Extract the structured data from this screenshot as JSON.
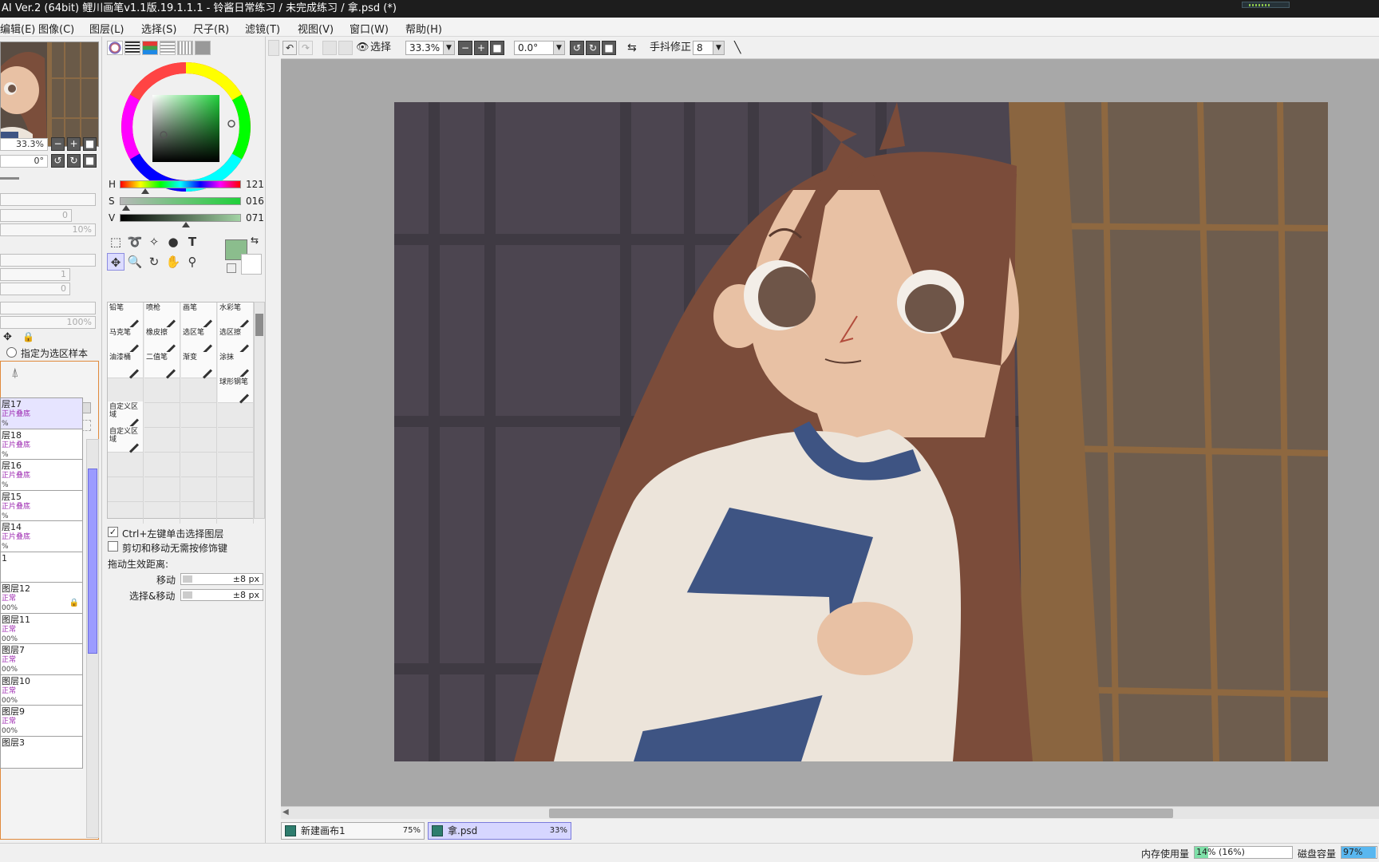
{
  "title": "AI Ver.2 (64bit) 鲤川画笔v1.1版.19.1.1.1 - 铃酱日常练习 / 未完成练习 / 拿.psd (*)",
  "menu": [
    "编辑(E)",
    "图像(C)",
    "图层(L)",
    "选择(S)",
    "尺子(R)",
    "滤镜(T)",
    "视图(V)",
    "窗口(W)",
    "帮助(H)"
  ],
  "navigator": {
    "zoom": "33.3%",
    "angle": "0°"
  },
  "left_fields": {
    "f1": "0",
    "f2": "10%",
    "f3": "1",
    "f4": "0",
    "f5": "100%"
  },
  "select_source_label": "指定为选区样本",
  "layers": [
    {
      "name": "层17",
      "mode": "正片叠底",
      "opacity": "%",
      "selected": true
    },
    {
      "name": "层18",
      "mode": "正片叠底",
      "opacity": "%"
    },
    {
      "name": "层16",
      "mode": "正片叠底",
      "opacity": "%"
    },
    {
      "name": "层15",
      "mode": "正片叠底",
      "opacity": "%"
    },
    {
      "name": "层14",
      "mode": "正片叠底",
      "opacity": "%"
    },
    {
      "name": "1",
      "mode": "",
      "opacity": ""
    },
    {
      "name": "图层12",
      "mode": "正常",
      "opacity": "00%",
      "locked": true
    },
    {
      "name": "图层11",
      "mode": "正常",
      "opacity": "00%"
    },
    {
      "name": "图层7",
      "mode": "正常",
      "opacity": "00%"
    },
    {
      "name": "图层10",
      "mode": "正常",
      "opacity": "00%"
    },
    {
      "name": "图层9",
      "mode": "正常",
      "opacity": "00%"
    },
    {
      "name": "图层3",
      "mode": "",
      "opacity": ""
    }
  ],
  "color": {
    "h_label": "H",
    "s_label": "S",
    "v_label": "V",
    "h": "121",
    "s": "016",
    "v": "071",
    "current": "#8bbd8d",
    "accent": "#1fd03a"
  },
  "brushes": [
    [
      "铅笔",
      "喷枪",
      "画笔",
      "水彩笔"
    ],
    [
      "马克笔",
      "橡皮擦",
      "选区笔",
      "选区擦"
    ],
    [
      "油漆桶",
      "二值笔",
      "渐变",
      "涂抹"
    ],
    [
      "",
      "",
      "",
      "球形钢笔"
    ],
    [
      "自定义区域",
      "",
      "",
      ""
    ],
    [
      "自定义区域",
      "",
      "",
      ""
    ]
  ],
  "options": {
    "ctrl_click_select": "Ctrl+左键单击选择图层",
    "cut_move_no_modifier": "剪切和移动无需按修饰键",
    "drag_distance_label": "拖动生效距离:",
    "move_label": "移动",
    "move_value": "±8 px",
    "select_move_label": "选择&移动",
    "select_move_value": "±8 px"
  },
  "toolbar": {
    "select_label": "选择",
    "zoom": "33.3%",
    "angle": "0.0°",
    "stabilizer_label": "手抖修正",
    "stabilizer_value": "8"
  },
  "tabs": [
    {
      "label": "新建画布1",
      "zoom": "75%"
    },
    {
      "label": "拿.psd",
      "zoom": "33%",
      "active": true
    }
  ],
  "status": {
    "memory_label": "内存使用量",
    "memory_value": "14% (16%)",
    "memory_fraction": 0.14,
    "disk_label": "磁盘容量",
    "disk_value": "97%",
    "disk_fraction": 0.97
  }
}
